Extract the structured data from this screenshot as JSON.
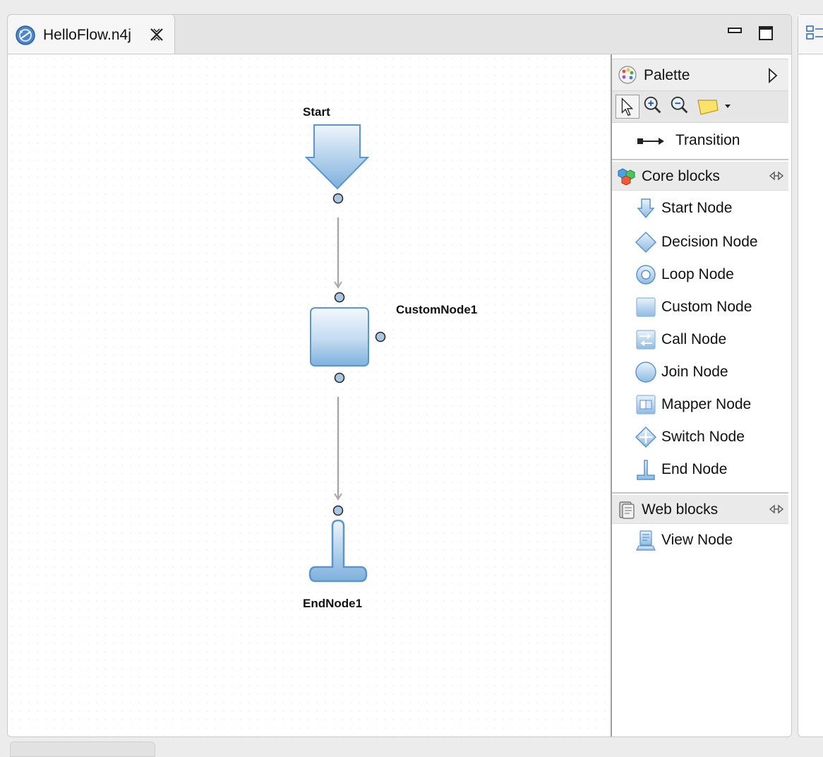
{
  "editor": {
    "tab": {
      "title": "HelloFlow.n4j",
      "icon": "flow-file-icon"
    },
    "window_controls": [
      "minimize-icon",
      "maximize-icon"
    ]
  },
  "diagram": {
    "nodes": [
      {
        "id": "start",
        "label": "Start",
        "icon": "start-node-arrow"
      },
      {
        "id": "custom",
        "label": "CustomNode1",
        "icon": "custom-node-box"
      },
      {
        "id": "end",
        "label": "EndNode1",
        "icon": "end-node-t"
      }
    ],
    "edges": [
      {
        "from": "start",
        "to": "custom"
      },
      {
        "from": "custom",
        "to": "end"
      }
    ]
  },
  "palette": {
    "title": "Palette",
    "tools": [
      "select-tool-icon",
      "zoom-in-icon",
      "zoom-out-icon",
      "note-icon"
    ],
    "transition_label": "Transition",
    "drawers": [
      {
        "title": "Core blocks",
        "items": [
          {
            "label": "Start Node",
            "icon": "start-node-icon"
          },
          {
            "label": "Decision Node",
            "icon": "decision-node-icon"
          },
          {
            "label": "Loop Node",
            "icon": "loop-node-icon"
          },
          {
            "label": "Custom Node",
            "icon": "custom-node-icon"
          },
          {
            "label": "Call Node",
            "icon": "call-node-icon"
          },
          {
            "label": "Join Node",
            "icon": "join-node-icon"
          },
          {
            "label": "Mapper Node",
            "icon": "mapper-node-icon"
          },
          {
            "label": "Switch Node",
            "icon": "switch-node-icon"
          },
          {
            "label": "End Node",
            "icon": "end-node-icon"
          }
        ]
      },
      {
        "title": "Web blocks",
        "items": [
          {
            "label": "View Node",
            "icon": "view-node-icon"
          }
        ]
      }
    ]
  },
  "colors": {
    "node_fill_top": "#eaf3fb",
    "node_fill_bottom": "#7fb2de",
    "node_stroke": "#5c94cc",
    "port_fill": "#a9c6e2",
    "edge": "#a8a8a8"
  }
}
